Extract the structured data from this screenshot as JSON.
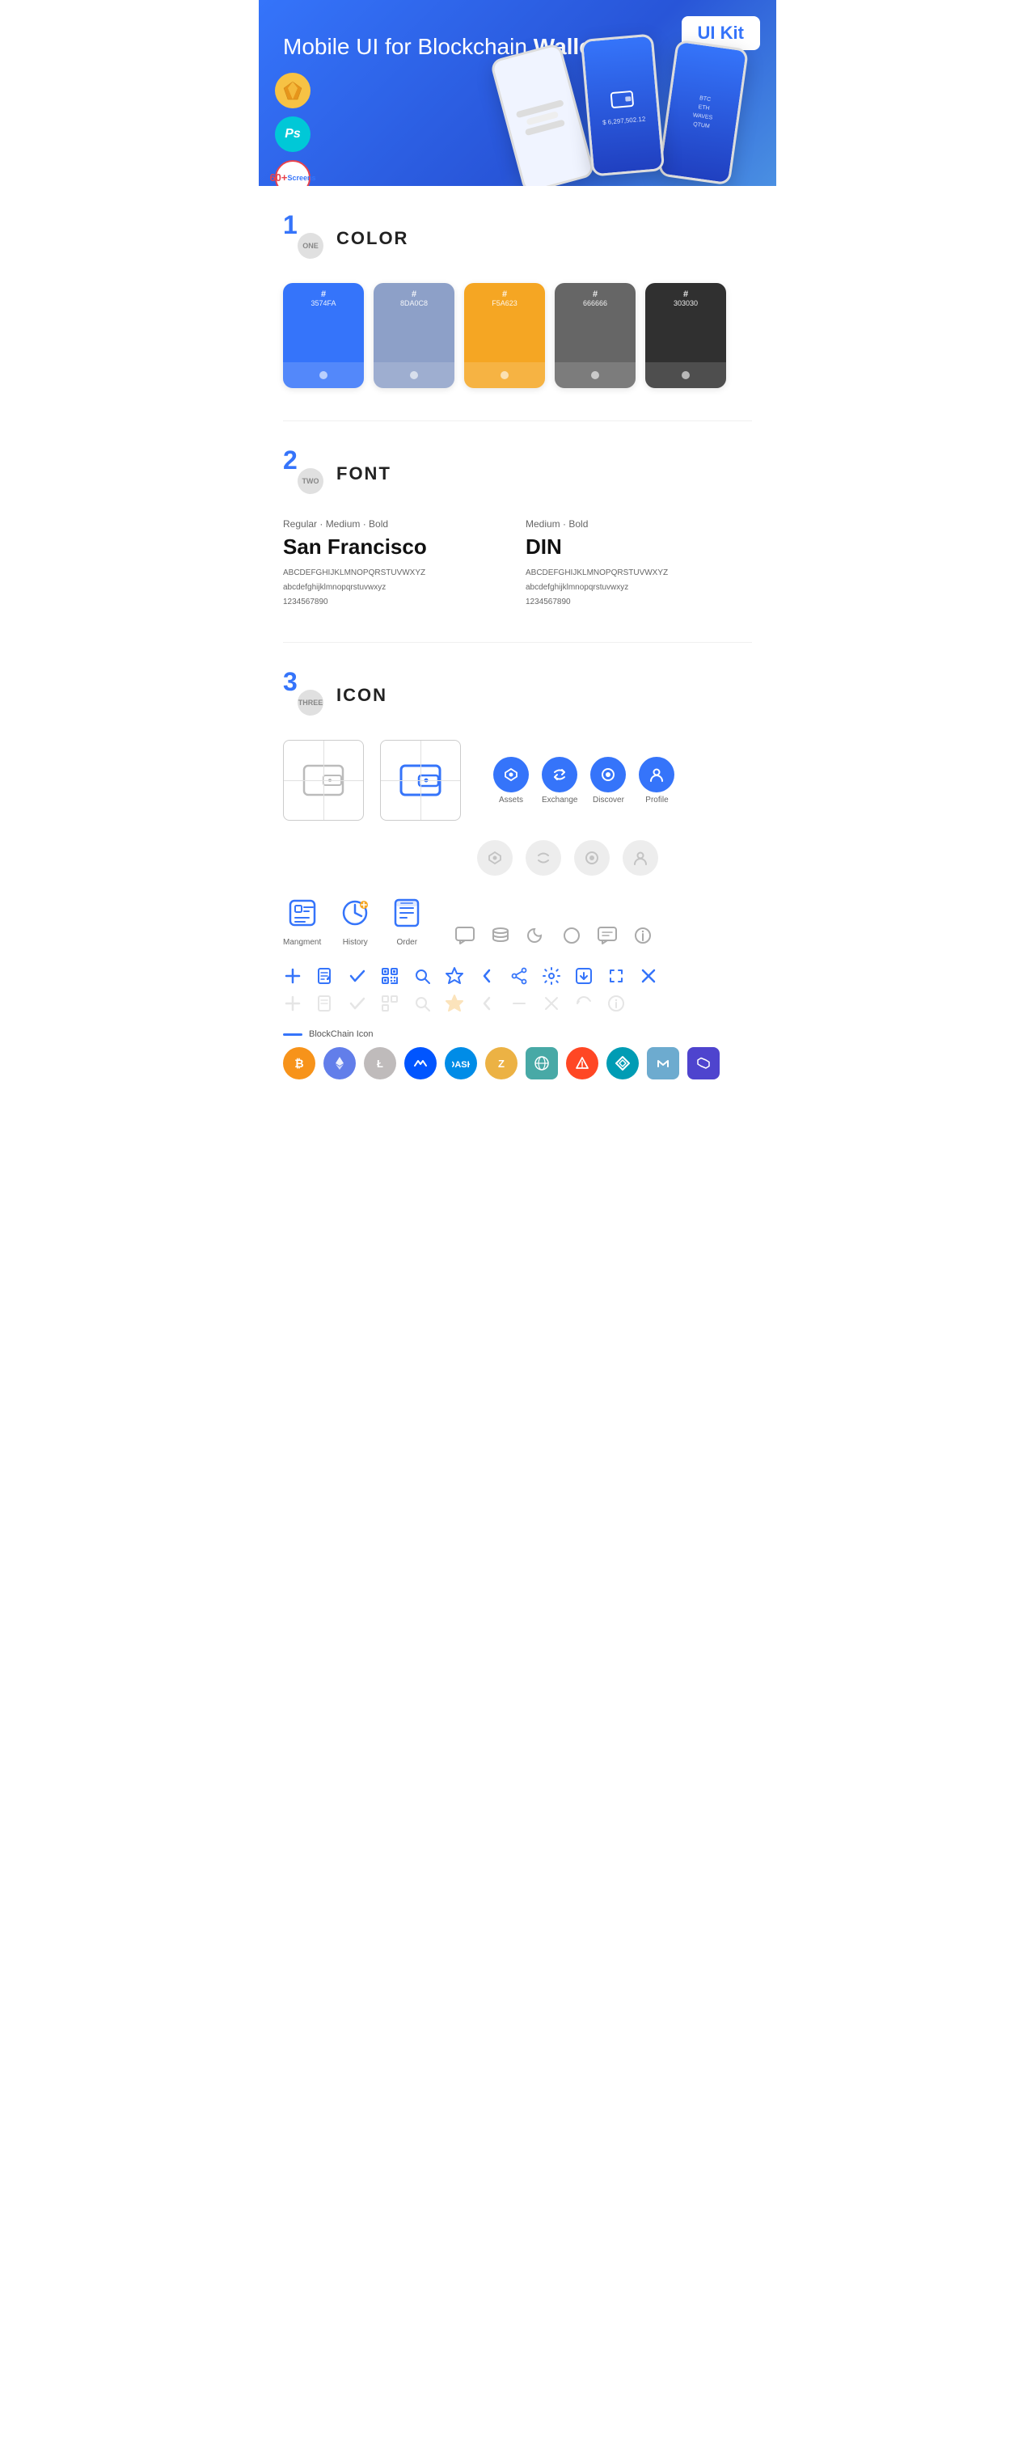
{
  "hero": {
    "title_normal": "Mobile UI for Blockchain ",
    "title_bold": "Wallet",
    "badge": "UI Kit",
    "badge_sketch": "Sketch",
    "badge_ps": "Ps",
    "badge_screens_count": "60+",
    "badge_screens_label": "Screens"
  },
  "sections": {
    "color": {
      "number": "1",
      "number_word": "ONE",
      "title": "COLOR",
      "swatches": [
        {
          "hex": "#3574FA",
          "label": "#\n3574FA",
          "bg": "#3574FA"
        },
        {
          "hex": "#8DA0C8",
          "label": "#\n8DA0C8",
          "bg": "#8DA0C8"
        },
        {
          "hex": "#F5A623",
          "label": "#\nF5A623",
          "bg": "#F5A623"
        },
        {
          "hex": "#666666",
          "label": "#\n666666",
          "bg": "#666666"
        },
        {
          "hex": "#303030",
          "label": "#\n303030",
          "bg": "#303030"
        }
      ]
    },
    "font": {
      "number": "2",
      "number_word": "TWO",
      "title": "FONT",
      "fonts": [
        {
          "weights": "Regular · Medium · Bold",
          "name": "San Francisco",
          "abc_upper": "ABCDEFGHIJKLMNOPQRSTUVWXYZ",
          "abc_lower": "abcdefghijklmnopqrstuvwxyz",
          "numbers": "1234567890"
        },
        {
          "weights": "Medium · Bold",
          "name": "DIN",
          "abc_upper": "ABCDEFGHIJKLMNOPQRSTUVWXYZ",
          "abc_lower": "abcdefghijklmnopqrstuvwxyz",
          "numbers": "1234567890"
        }
      ]
    },
    "icon": {
      "number": "3",
      "number_word": "THREE",
      "title": "ICON",
      "nav_icons": [
        {
          "label": "Assets",
          "color": "#3574FA"
        },
        {
          "label": "Exchange",
          "color": "#3574FA"
        },
        {
          "label": "Discover",
          "color": "#3574FA"
        },
        {
          "label": "Profile",
          "color": "#3574FA"
        }
      ],
      "tab_icons": [
        {
          "label": "Mangment",
          "color": "#3574FA"
        },
        {
          "label": "History",
          "color": "#3574FA"
        },
        {
          "label": "Order",
          "color": "#3574FA"
        }
      ],
      "blockchain_label": "BlockChain Icon",
      "blockchain_icons": [
        {
          "label": "BTC",
          "color": "#F7931A"
        },
        {
          "label": "ETH",
          "color": "#627EEA"
        },
        {
          "label": "LTC",
          "color": "#BFBBBB"
        },
        {
          "label": "WAVES",
          "color": "#0055FF"
        },
        {
          "label": "DASH",
          "color": "#008CE7"
        },
        {
          "label": "ZEC",
          "color": "#ECB244"
        },
        {
          "label": "NET",
          "color": "#48A9A6"
        },
        {
          "label": "BAT",
          "color": "#FF4724"
        },
        {
          "label": "GNO",
          "color": "#009CB4"
        },
        {
          "label": "MKR",
          "color": "#6DABCF"
        },
        {
          "label": "POLY",
          "color": "#4E44CE"
        }
      ]
    }
  }
}
